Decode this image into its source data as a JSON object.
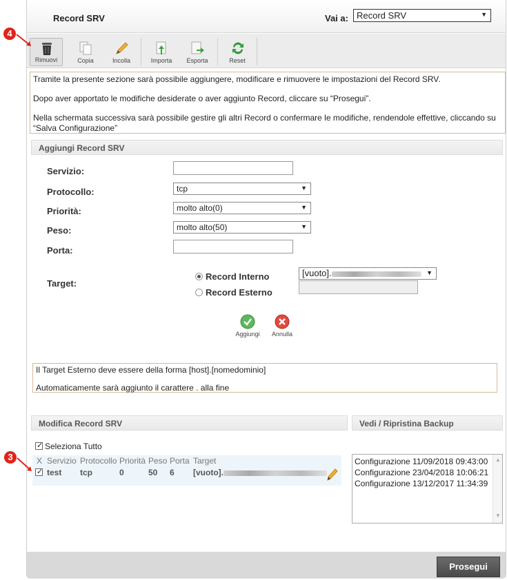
{
  "header": {
    "title": "Record SRV",
    "goto_label": "Vai a:",
    "goto_value": "Record SRV"
  },
  "toolbar": {
    "remove": "Rimuovi",
    "copy": "Copia",
    "paste": "Incolla",
    "import": "Importa",
    "export": "Esporta",
    "reset": "Reset"
  },
  "info": {
    "line1": "Tramite la presente sezione sarà possibile aggiungere, modificare e rimuovere le impostazioni del Record SRV.",
    "line2": "Dopo aver apportato le modifiche desiderate o aver aggiunto Record, cliccare su “Prosegui”.",
    "line3": "Nella schermata successiva sarà possibile gestire gli altri Record o confermare le modifiche, rendendole effettive, cliccando su “Salva Configurazione”"
  },
  "add_section": {
    "title": "Aggiungi Record SRV",
    "service_label": "Servizio:",
    "protocol_label": "Protocollo:",
    "protocol_value": "tcp",
    "priority_label": "Priorità:",
    "priority_value": "molto alto(0)",
    "weight_label": "Peso:",
    "weight_value": "molto alto(50)",
    "port_label": "Porta:",
    "target_label": "Target:",
    "internal_label": "Record Interno",
    "external_label": "Record Esterno",
    "internal_value": "[vuoto].",
    "add_label": "Aggiungi",
    "cancel_label": "Annulla"
  },
  "note": {
    "line1": "Il Target Esterno deve essere della forma [host].[nomedominio]",
    "line2": "Automaticamente sarà aggiunto il carattere . alla fine"
  },
  "edit_section": {
    "title": "Modifica Record SRV",
    "select_all": "Seleziona Tutto",
    "columns": [
      "X",
      "Servizio",
      "Protocollo",
      "Priorità",
      "Peso",
      "Porta",
      "Target"
    ],
    "row": {
      "service": "test",
      "protocol": "tcp",
      "priority": "0",
      "weight": "50",
      "port": "6",
      "target": "[vuoto]."
    }
  },
  "backup_section": {
    "title": "Vedi / Ripristina Backup",
    "items": [
      "Configurazione 11/09/2018 09:43:00",
      "Configurazione 23/04/2018 10:06:21",
      "Configurazione 13/12/2017 11:34:39"
    ]
  },
  "footer": {
    "next_label": "Prosegui"
  },
  "badges": {
    "four": "4",
    "three": "3"
  },
  "colors": {
    "badge": "#e0241b",
    "accent_green": "#3aa53a",
    "accent_red": "#d63b2f"
  }
}
